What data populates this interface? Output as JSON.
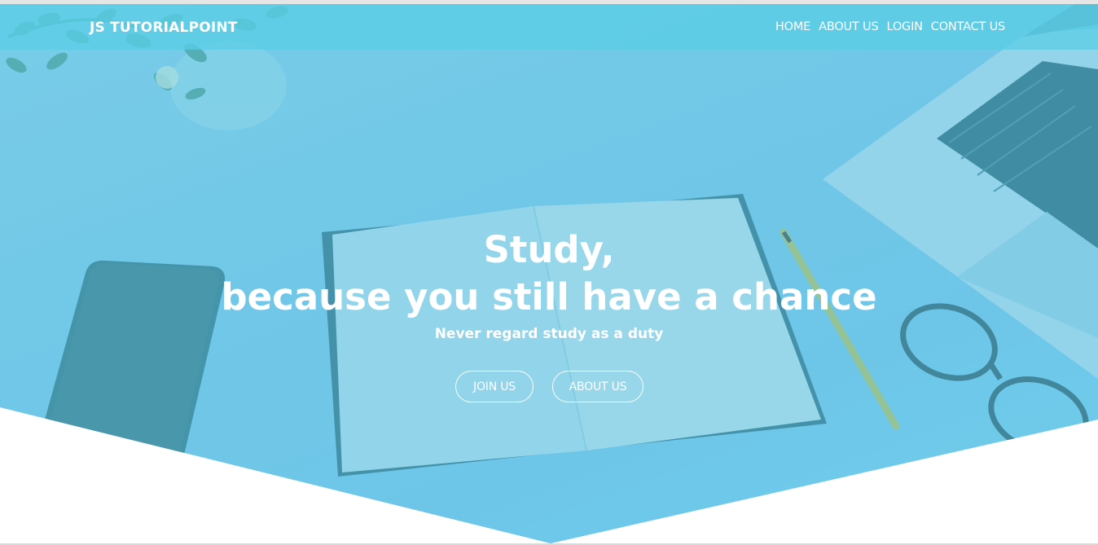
{
  "brand": "JS TUTORIALPOINT",
  "nav": [
    "HOME",
    "ABOUT US",
    "LOGIN",
    "CONTACT US"
  ],
  "hero": {
    "headline_line1": "Study,",
    "headline_line2": "because you still have a chance",
    "tagline": "Never regard study as a duty",
    "buttons": {
      "join": "JOIN US",
      "about": "ABOUT US"
    }
  },
  "colors": {
    "hero_overlay": "#6ec6e8",
    "navbar": "#5acde6",
    "text": "#ffffff"
  }
}
